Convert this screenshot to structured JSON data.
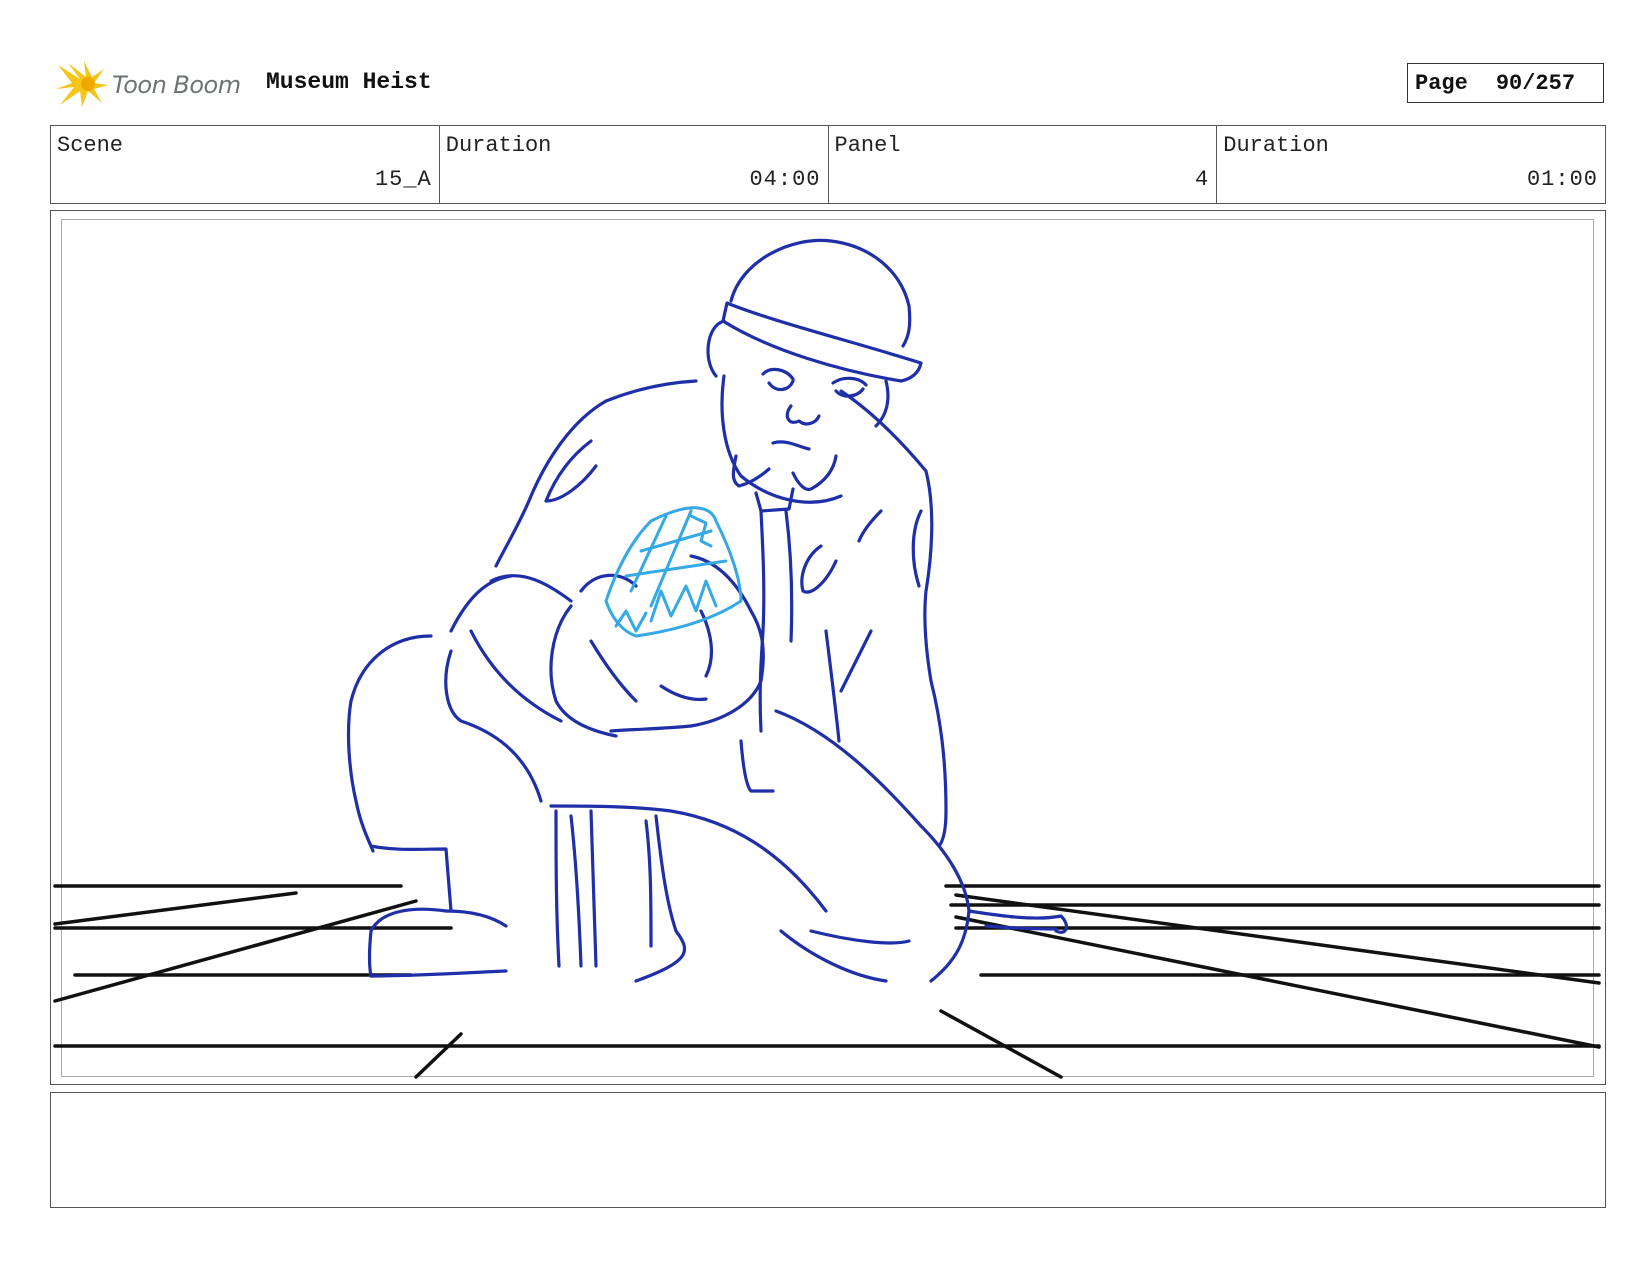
{
  "header": {
    "logo_text": "Toon Boom",
    "project_title": "Museum Heist",
    "page_label": "Page",
    "page_value": "90/257"
  },
  "info": {
    "scene_label": "Scene",
    "scene_value": "15_A",
    "scene_duration_label": "Duration",
    "scene_duration_value": "04:00",
    "panel_label": "Panel",
    "panel_value": "4",
    "panel_duration_label": "Duration",
    "panel_duration_value": "01:00"
  },
  "notes": {
    "text": ""
  },
  "colors": {
    "sketch_stroke": "#1f2fa8",
    "gem_stroke": "#35a8e6",
    "floor_stroke": "#111111",
    "logo_yellow": "#f5c518"
  }
}
